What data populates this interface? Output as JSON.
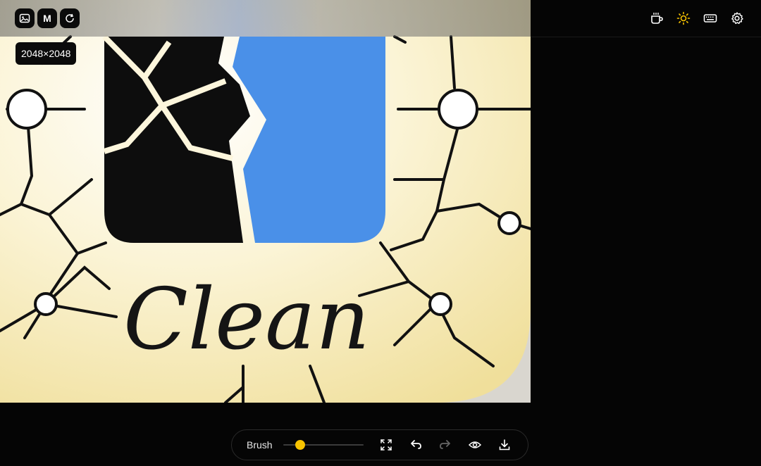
{
  "toolbar": {
    "left": [
      {
        "name": "image-icon"
      },
      {
        "name": "manual-mode",
        "label": "M"
      },
      {
        "name": "refresh-icon"
      }
    ],
    "right": [
      {
        "name": "coffee-icon"
      },
      {
        "name": "sun-icon"
      },
      {
        "name": "keyboard-icon"
      },
      {
        "name": "gear-icon"
      }
    ]
  },
  "image": {
    "dimensions": "2048×2048",
    "caption": "Clean"
  },
  "bottom_toolbar": {
    "brush_label": "Brush",
    "brush_size_fraction": 0.21,
    "icons": [
      "expand-icon",
      "undo-icon",
      "redo-icon",
      "eye-icon",
      "download-icon"
    ]
  },
  "colors": {
    "accent": "#f7c300",
    "background": "#050505",
    "image_cream": "#f6efc9",
    "image_blue": "#4a90e8"
  }
}
